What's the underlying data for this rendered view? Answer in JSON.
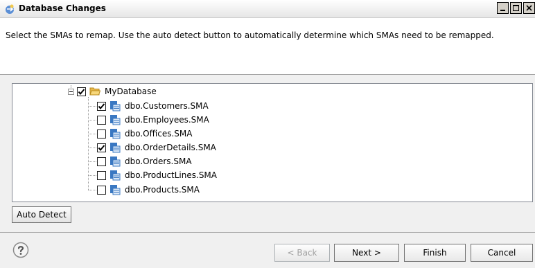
{
  "window": {
    "title": "Database Changes",
    "controls": [
      "minimize-icon",
      "maximize-icon",
      "close-icon"
    ]
  },
  "header": {
    "instruction": "Select the SMAs to remap.  Use the auto detect button to automatically determine which SMAs need to be remapped."
  },
  "tree": {
    "root": {
      "label": "MyDatabase",
      "checked": true,
      "expanded": true,
      "icon": "folder-open-icon"
    },
    "items": [
      {
        "label": "dbo.Customers.SMA",
        "checked": true,
        "icon": "sma-file-icon"
      },
      {
        "label": "dbo.Employees.SMA",
        "checked": false,
        "icon": "sma-file-icon"
      },
      {
        "label": "dbo.Offices.SMA",
        "checked": false,
        "icon": "sma-file-icon"
      },
      {
        "label": "dbo.OrderDetails.SMA",
        "checked": true,
        "icon": "sma-file-icon"
      },
      {
        "label": "dbo.Orders.SMA",
        "checked": false,
        "icon": "sma-file-icon"
      },
      {
        "label": "dbo.ProductLines.SMA",
        "checked": false,
        "icon": "sma-file-icon"
      },
      {
        "label": "dbo.Products.SMA",
        "checked": false,
        "icon": "sma-file-icon"
      }
    ]
  },
  "buttons": {
    "auto_detect": "Auto Detect",
    "back": "< Back",
    "next": "Next >",
    "finish": "Finish",
    "cancel": "Cancel"
  },
  "colors": {
    "background": "#f0f0f0",
    "panel": "#ffffff",
    "disabled_text": "#a0a0a0"
  }
}
